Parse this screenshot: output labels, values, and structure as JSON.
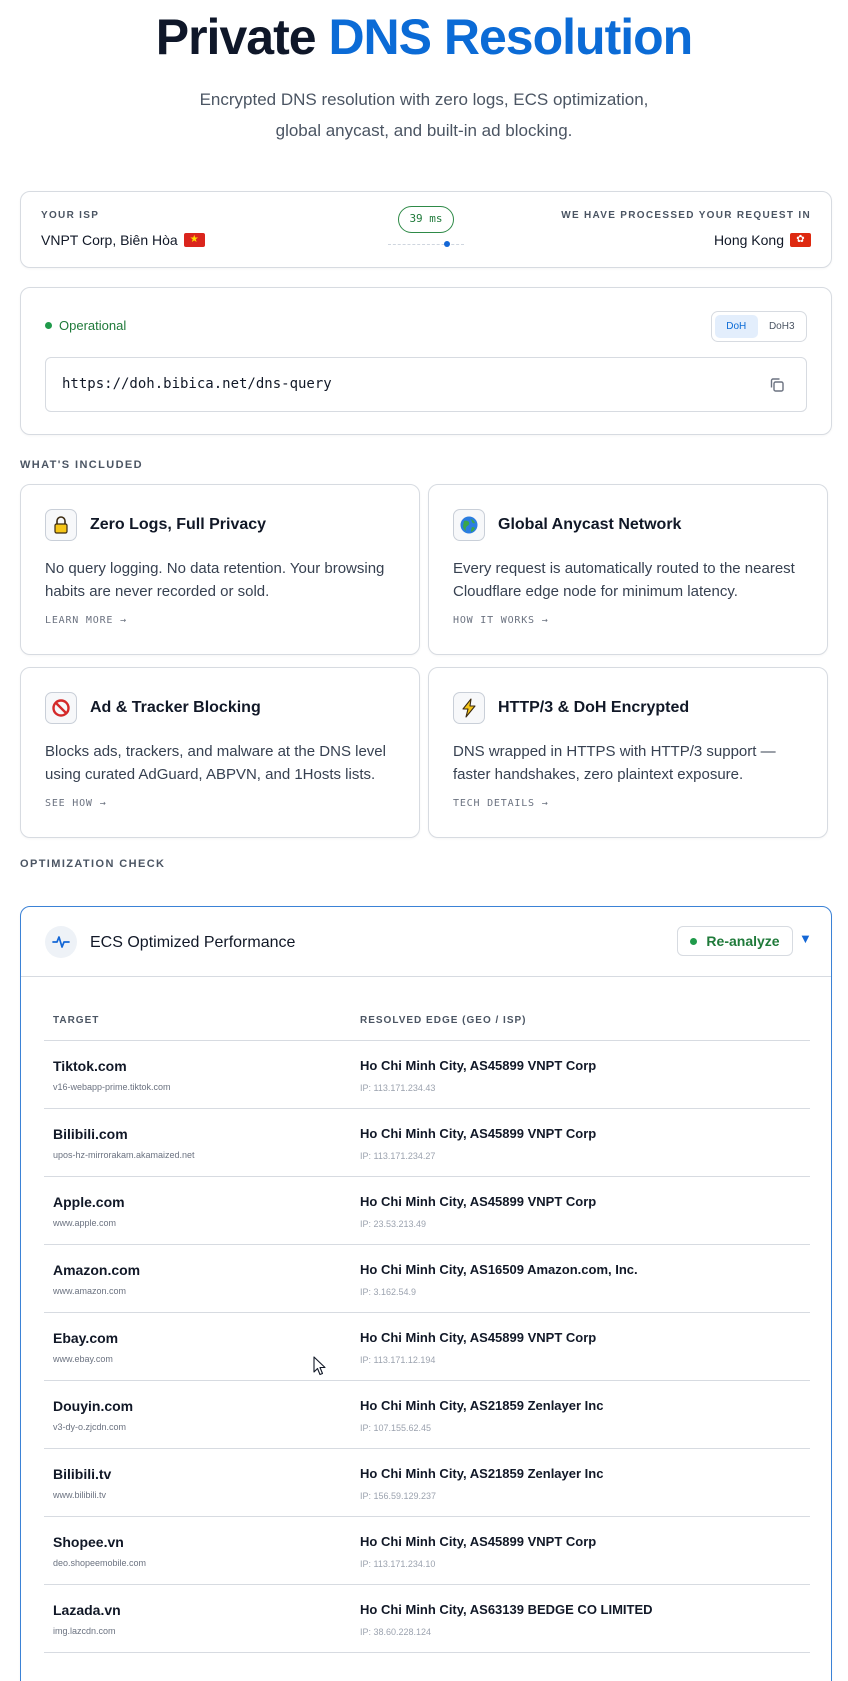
{
  "hero": {
    "title_main": "Private",
    "title_accent": "DNS Resolution",
    "subtitle_line1": "Encrypted DNS resolution with zero logs, ECS optimization,",
    "subtitle_line2": "global anycast, and built-in ad blocking."
  },
  "isp": {
    "label": "YOUR ISP",
    "value": "VNPT Corp, Biên Hòa",
    "latency": "39 ms",
    "processed_label": "WE HAVE PROCESSED YOUR REQUEST IN",
    "processed_value": "Hong Kong"
  },
  "endpoint": {
    "status": "Operational",
    "protocols": [
      "DoH",
      "DoH3"
    ],
    "active_protocol": "DoH",
    "url": "https://doh.bibica.net/dns-query"
  },
  "included": {
    "label": "WHAT'S INCLUDED",
    "features": [
      {
        "icon": "lock-icon",
        "title": "Zero Logs, Full Privacy",
        "desc": "No query logging. No data retention. Your browsing habits are never recorded or sold.",
        "link": "LEARN MORE →"
      },
      {
        "icon": "globe-icon",
        "title": "Global Anycast Network",
        "desc": "Every request is automatically routed to the nearest Cloudflare edge node for minimum latency.",
        "link": "HOW IT WORKS →"
      },
      {
        "icon": "prohibited-icon",
        "title": "Ad & Tracker Blocking",
        "desc": "Blocks ads, trackers, and malware at the DNS level using curated AdGuard, ABPVN, and 1Hosts lists.",
        "link": "SEE HOW →"
      },
      {
        "icon": "lightning-icon",
        "title": "HTTP/3 & DoH Encrypted",
        "desc": "DNS wrapped in HTTPS with HTTP/3 support — faster handshakes, zero plaintext exposure.",
        "link": "TECH DETAILS →"
      }
    ]
  },
  "optimization": {
    "label": "OPTIMIZATION CHECK",
    "title": "ECS Optimized Performance",
    "reanalyze": "Re-analyze",
    "col_target": "TARGET",
    "col_edge": "RESOLVED EDGE (GEO / ISP)",
    "rows": [
      {
        "target": "Tiktok.com",
        "host": "v16-webapp-prime.tiktok.com",
        "edge": "Ho Chi Minh City, AS45899 VNPT Corp",
        "ip": "IP: 113.171.234.43"
      },
      {
        "target": "Bilibili.com",
        "host": "upos-hz-mirrorakam.akamaized.net",
        "edge": "Ho Chi Minh City, AS45899 VNPT Corp",
        "ip": "IP: 113.171.234.27"
      },
      {
        "target": "Apple.com",
        "host": "www.apple.com",
        "edge": "Ho Chi Minh City, AS45899 VNPT Corp",
        "ip": "IP: 23.53.213.49"
      },
      {
        "target": "Amazon.com",
        "host": "www.amazon.com",
        "edge": "Ho Chi Minh City, AS16509 Amazon.com, Inc.",
        "ip": "IP: 3.162.54.9"
      },
      {
        "target": "Ebay.com",
        "host": "www.ebay.com",
        "edge": "Ho Chi Minh City, AS45899 VNPT Corp",
        "ip": "IP: 113.171.12.194"
      },
      {
        "target": "Douyin.com",
        "host": "v3-dy-o.zjcdn.com",
        "edge": "Ho Chi Minh City, AS21859 Zenlayer Inc",
        "ip": "IP: 107.155.62.45"
      },
      {
        "target": "Bilibili.tv",
        "host": "www.bilibili.tv",
        "edge": "Ho Chi Minh City, AS21859 Zenlayer Inc",
        "ip": "IP: 156.59.129.237"
      },
      {
        "target": "Shopee.vn",
        "host": "deo.shopeemobile.com",
        "edge": "Ho Chi Minh City, AS45899 VNPT Corp",
        "ip": "IP: 113.171.234.10"
      },
      {
        "target": "Lazada.vn",
        "host": "img.lazcdn.com",
        "edge": "Ho Chi Minh City, AS63139 BEDGE CO LIMITED",
        "ip": "IP: 38.60.228.124"
      }
    ]
  }
}
